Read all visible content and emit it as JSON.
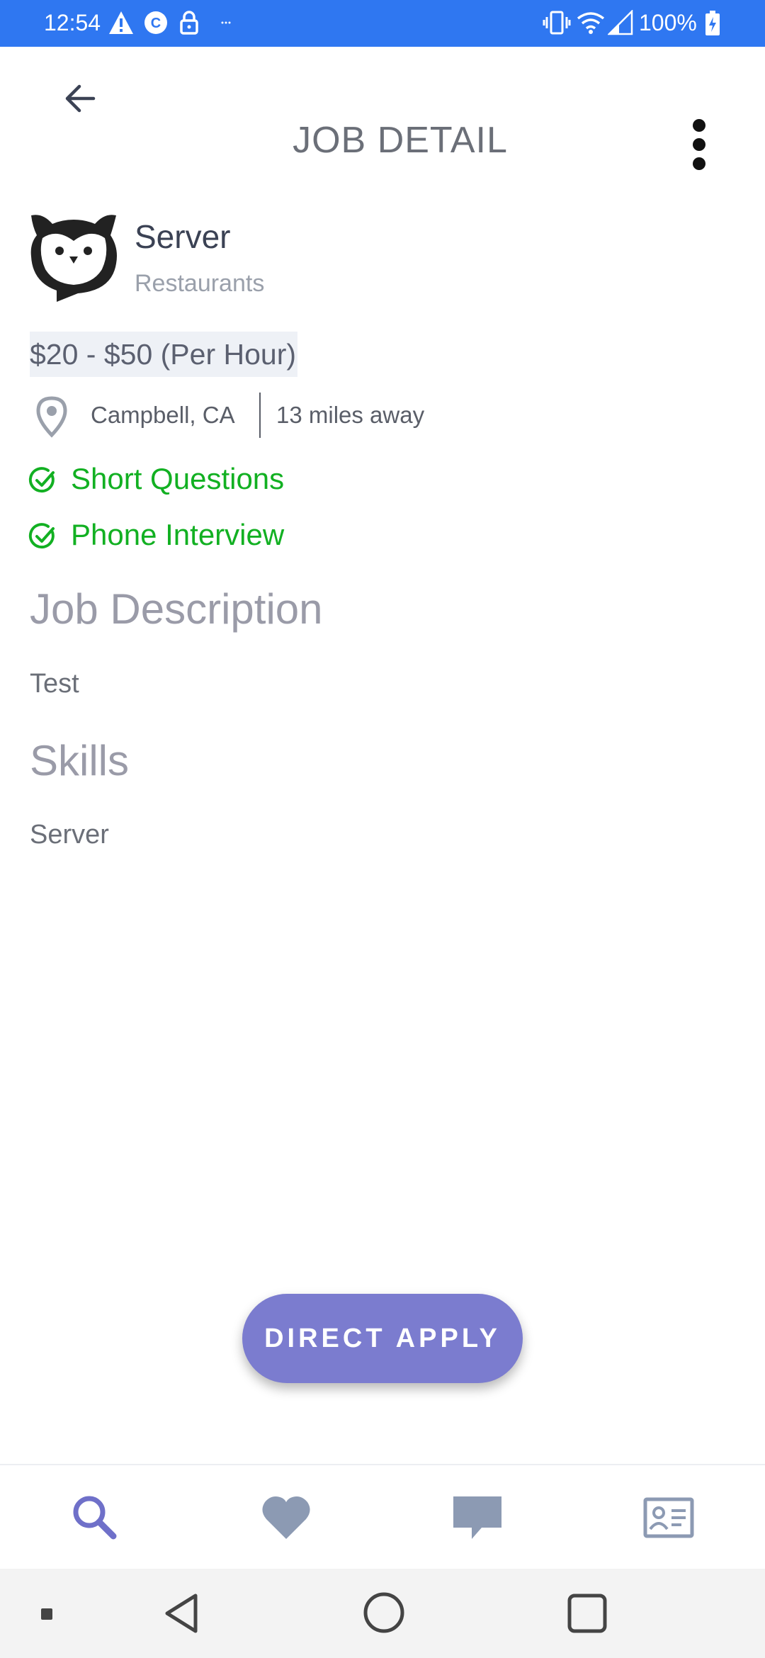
{
  "status_bar": {
    "time": "12:54",
    "battery": "100%"
  },
  "header": {
    "title": "JOB DETAIL"
  },
  "job": {
    "title": "Server",
    "category": "Restaurants",
    "salary": "$20 - $50 (Per Hour)",
    "location": "Campbell, CA",
    "distance": "13 miles away",
    "features": [
      "Short Questions",
      "Phone Interview"
    ],
    "description_heading": "Job Description",
    "description": "Test",
    "skills_heading": "Skills",
    "skills": "Server"
  },
  "actions": {
    "apply_label": "DIRECT APPLY"
  },
  "colors": {
    "status_bar": "#2f77f1",
    "accent": "#7b7ccf",
    "success": "#12b022",
    "nav_active": "#6f70c9",
    "nav_inactive": "#8c9ab3"
  },
  "icons": {
    "nav": [
      "search-icon",
      "heart-icon",
      "chat-icon",
      "profile-card-icon"
    ]
  }
}
